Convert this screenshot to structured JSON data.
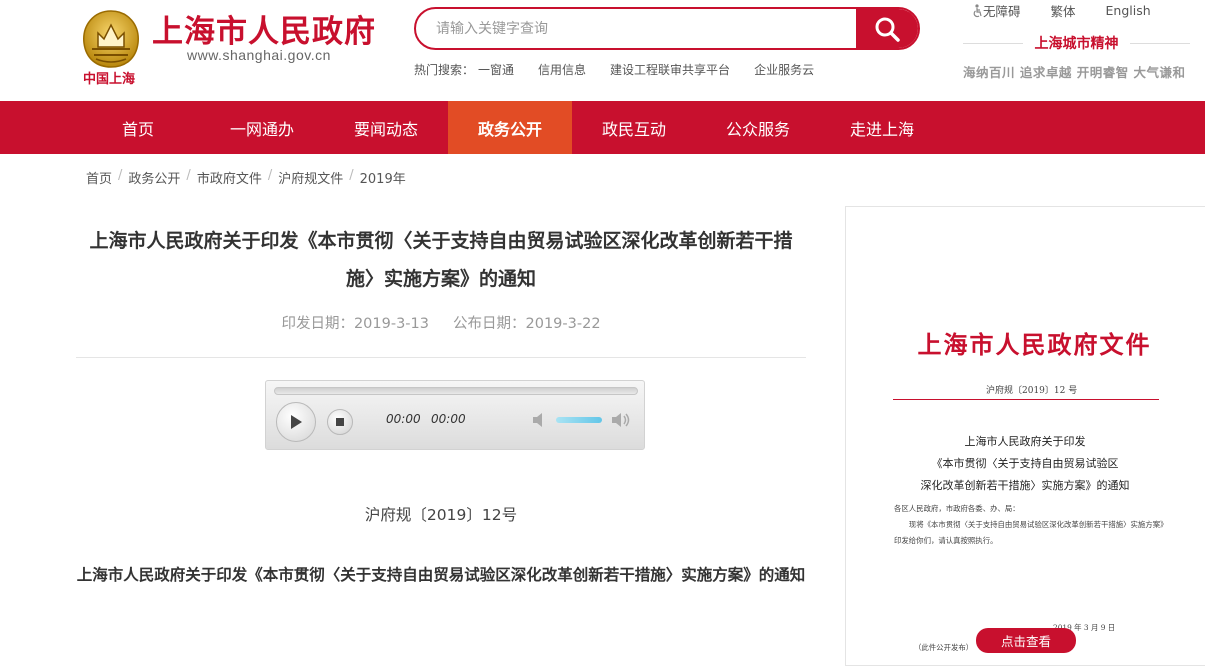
{
  "brand": {
    "title": "上海市人民政府",
    "url": "www.shanghai.gov.cn",
    "emblem_caption": "中国上海",
    "color": "#c8102e"
  },
  "search": {
    "placeholder": "请输入关键字查询",
    "hot_label": "热门搜索：",
    "hot_terms": [
      "一窗通",
      "信用信息",
      "建设工程联审共享平台",
      "企业服务云"
    ]
  },
  "top_links": {
    "accessibility": "无障碍",
    "traditional": "繁体",
    "english": "English"
  },
  "spirit": {
    "title": "上海城市精神",
    "words": "海纳百川 追求卓越 开明睿智 大气谦和"
  },
  "nav": {
    "items": [
      "首页",
      "一网通办",
      "要闻动态",
      "政务公开",
      "政民互动",
      "公众服务",
      "走进上海"
    ],
    "active_index": 3,
    "bg": "#c8102e",
    "active_bg": "#e24c25"
  },
  "breadcrumb": [
    "首页",
    "政务公开",
    "市政府文件",
    "沪府规文件",
    "2019年"
  ],
  "article": {
    "title": "上海市人民政府关于印发《本市贯彻〈关于支持自由贸易试验区深化改革创新若干措施〉实施方案》的通知",
    "issue_date": "印发日期：2019-3-13",
    "publish_date": "公布日期：2019-3-22",
    "doc_number": "沪府规〔2019〕12号",
    "body_title": "上海市人民政府关于印发《本市贯彻〈关于支持自由贸易试验区深化改革创新若干措施〉实施方案》的通知"
  },
  "player": {
    "current_time": "00:00",
    "duration": "00:00",
    "progress": 0,
    "volume": 0.8
  },
  "preview": {
    "header": "上海市人民政府文件",
    "doc_number": "沪府规〔2019〕12 号",
    "title_lines": [
      "上海市人民政府关于印发",
      "《本市贯彻〈关于支持自由贸易试验区",
      "深化改革创新若干措施〉实施方案》的通知"
    ],
    "recipients": "各区人民政府，市政府各委、办、局：",
    "body": "现将《本市贯彻〈关于支持自由贸易试验区深化改革创新若干措施〉实施方案》印发给你们，请认真按照执行。",
    "date": "2019 年 3 月 9 日",
    "note": "（此件公开发布）",
    "view_button": "点击查看"
  }
}
